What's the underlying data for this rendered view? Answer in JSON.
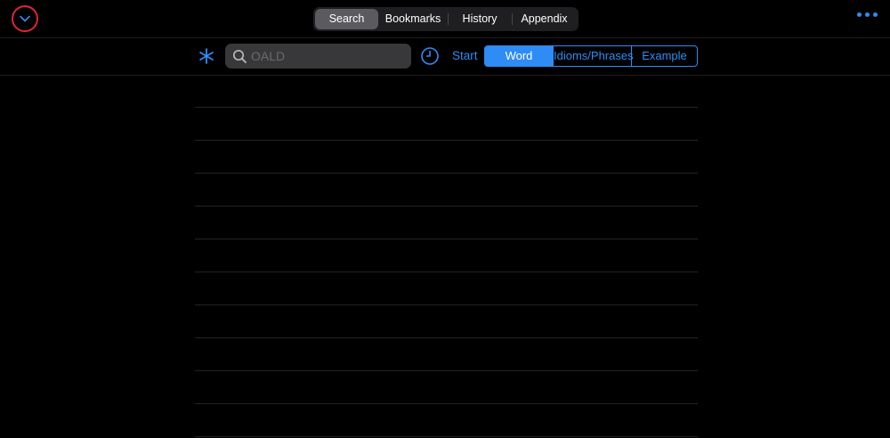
{
  "topbar": {
    "tabs": [
      {
        "label": "Search",
        "active": true
      },
      {
        "label": "Bookmarks",
        "active": false
      },
      {
        "label": "History",
        "active": false
      },
      {
        "label": "Appendix",
        "active": false
      }
    ],
    "collapse_icon": "chevron-down-icon",
    "more_icon": "ellipsis-icon"
  },
  "searchbar": {
    "wildcard_icon": "asterisk-icon",
    "search_icon": "magnifier-icon",
    "placeholder": "OALD",
    "value": "",
    "history_icon": "clock-icon",
    "start_label": "Start"
  },
  "modes": [
    {
      "label": "Word",
      "active": true
    },
    {
      "label": "Idioms/Phrases",
      "active": false
    },
    {
      "label": "Example",
      "active": false
    }
  ],
  "results": {
    "rows": [
      "",
      "",
      "",
      "",
      "",
      "",
      "",
      "",
      "",
      "",
      ""
    ]
  },
  "colors": {
    "accent": "#2f8cf5",
    "highlight_ring": "#e0243a",
    "background": "#000000"
  }
}
